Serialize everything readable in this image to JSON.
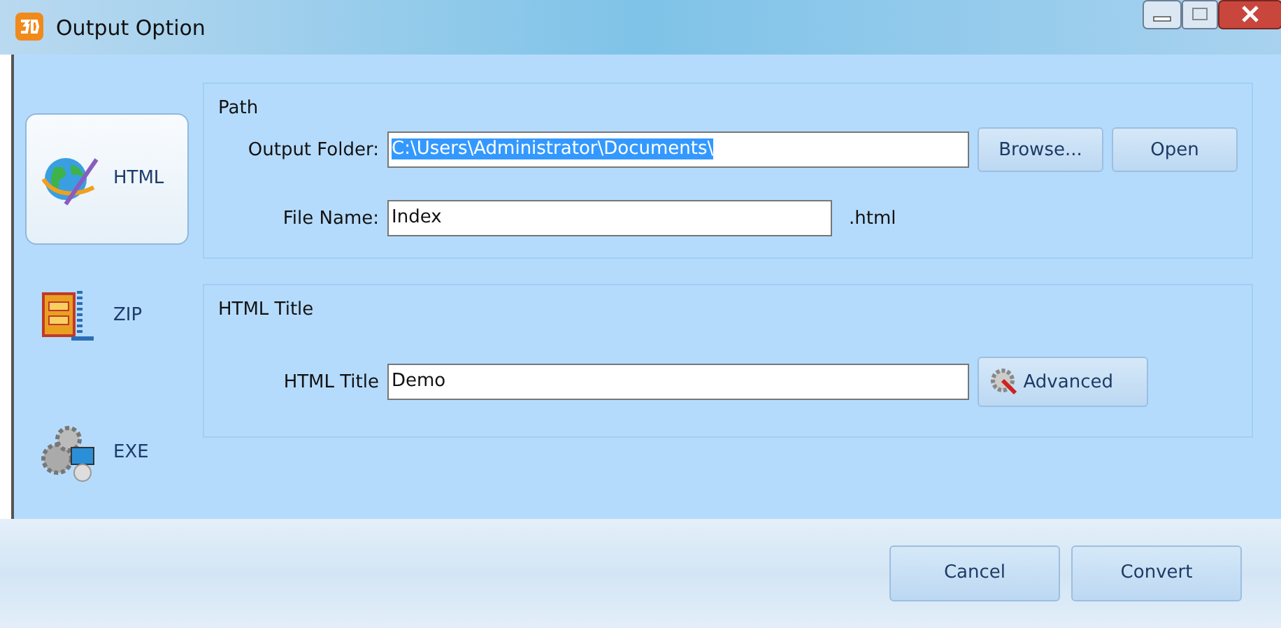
{
  "window": {
    "title": "Output Option"
  },
  "sidebar": {
    "items": [
      {
        "label": "HTML",
        "kind": "html",
        "selected": true
      },
      {
        "label": "ZIP",
        "kind": "zip",
        "selected": false
      },
      {
        "label": "EXE",
        "kind": "exe",
        "selected": false
      }
    ]
  },
  "path_group": {
    "title": "Path",
    "output_folder": {
      "label": "Output Folder:",
      "value": "C:\\Users\\Administrator\\Documents\\",
      "text_selected": true
    },
    "browse_button": "Browse...",
    "open_button": "Open",
    "file_name": {
      "label": "File Name:",
      "value": "Index"
    },
    "extension": ".html"
  },
  "title_group": {
    "title": "HTML Title",
    "html_title": {
      "label": "HTML Title",
      "value": "Demo"
    },
    "advanced_button": "Advanced"
  },
  "buttons": [
    "Cancel",
    "Convert"
  ]
}
